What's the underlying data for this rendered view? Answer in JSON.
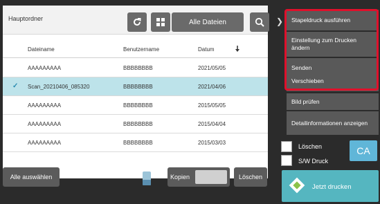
{
  "panel": {
    "title": "Hauptordner",
    "filter_label": "Alle Dateien",
    "columns": [
      "Dateiname",
      "Benutzername",
      "Datum"
    ]
  },
  "rows": [
    {
      "name": "AAAAAAAAA",
      "user": "BBBBBBBB",
      "date": "2021/05/05",
      "selected": false
    },
    {
      "name": "Scan_20210406_085320",
      "user": "BBBBBBBB",
      "date": "2021/04/06",
      "selected": true
    },
    {
      "name": "AAAAAAAAA",
      "user": "BBBBBBBB",
      "date": "2015/05/05",
      "selected": false
    },
    {
      "name": "AAAAAAAAA",
      "user": "BBBBBBBB",
      "date": "2015/04/04",
      "selected": false
    },
    {
      "name": "AAAAAAAAA",
      "user": "BBBBBBBB",
      "date": "2015/03/03",
      "selected": false
    }
  ],
  "bottom": {
    "select_all": "Alle auswählen",
    "copies": "Kopien",
    "delete": "Löschen"
  },
  "menu": {
    "items": [
      "Stapeldruck ausführen",
      "Einstellung zum Drucken ändern",
      "Senden",
      "Verschieben",
      "Bild prüfen",
      "Detailinformationen anzeigen"
    ]
  },
  "options": {
    "delete_label": "Löschen",
    "bw_label": "S/W Druck",
    "ca_label": "CA",
    "start_label": "Jetzt drucken"
  },
  "colors": {
    "selected_row": "#bde3ea",
    "highlight": "#e0102b",
    "start_button": "#55b6c0",
    "ca_button": "#60b6d8"
  }
}
